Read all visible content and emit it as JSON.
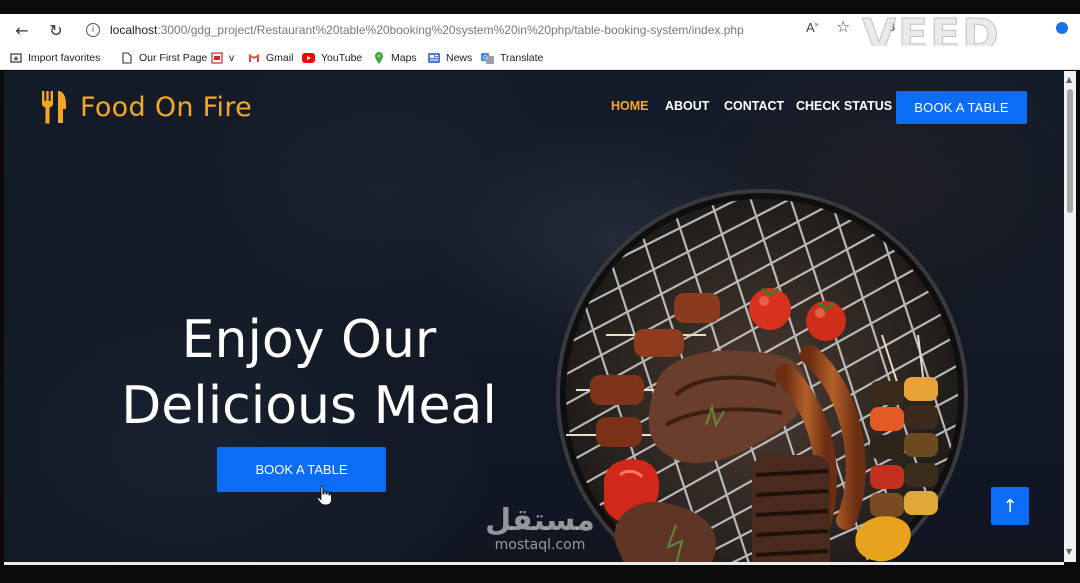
{
  "browser": {
    "url_host": "localhost",
    "url_rest": ":3000/gdg_project/Restaurant%20table%20booking%20system%20in%20php/table-booking-system/index.php",
    "read_aloud_label": "A",
    "bookmarks": [
      {
        "label": "Import favorites",
        "icon": "import-icon"
      },
      {
        "label": "Our First Page",
        "icon": "page-icon"
      },
      {
        "label": "v",
        "icon": "pdf-icon"
      },
      {
        "label": "Gmail",
        "icon": "gmail-icon"
      },
      {
        "label": "YouTube",
        "icon": "youtube-icon"
      },
      {
        "label": "Maps",
        "icon": "maps-icon"
      },
      {
        "label": "News",
        "icon": "news-icon"
      },
      {
        "label": "Translate",
        "icon": "translate-icon"
      }
    ],
    "colors": {
      "youtube": "#ff0000",
      "gmail": "#ea4335",
      "maps": "#34a853"
    }
  },
  "site": {
    "brand": "Food On Fire",
    "nav": {
      "home": "HOME",
      "about": "ABOUT",
      "contact": "CONTACT",
      "check_status": "CHECK STATUS",
      "book": "BOOK A TABLE"
    },
    "hero": {
      "line1": "Enjoy Our",
      "line2": "Delicious Meal",
      "cta": "BOOK A TABLE"
    },
    "to_top": "↑",
    "colors": {
      "accent": "#f5a623",
      "primary": "#0b6cf5",
      "text": "#ffffff"
    }
  },
  "watermarks": {
    "veed": "VEED",
    "mostaql_ar": "مستقل",
    "mostaql_lat": "mostaql.com"
  }
}
